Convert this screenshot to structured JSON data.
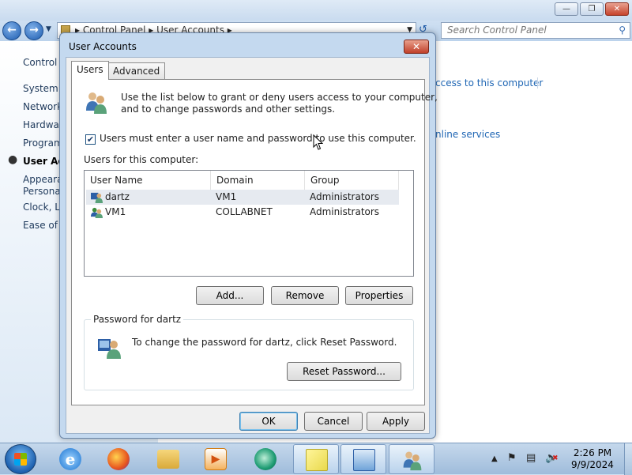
{
  "background_window": {
    "address_crumbs": [
      "Control Panel",
      "User Accounts"
    ],
    "search_placeholder": "Search Control Panel",
    "sidebar": {
      "home": "Control P",
      "items": [
        "System a",
        "Network",
        "Hardwar",
        "Program",
        "User Acc",
        "Appeara",
        "Personal",
        "Clock, La",
        "Ease of A"
      ],
      "current_index": 4
    },
    "links": [
      "ccess to this computer",
      "nline services"
    ]
  },
  "dialog": {
    "title": "User Accounts",
    "tabs": [
      "Users",
      "Advanced"
    ],
    "active_tab": "Users",
    "intro_text_line1": "Use the list below to grant or deny users access to your computer,",
    "intro_text_line2": "and to change passwords and other settings.",
    "checkbox_label": "Users must enter a user name and password to use this computer.",
    "checkbox_checked": true,
    "users_label": "Users for this computer:",
    "columns": [
      "User Name",
      "Domain",
      "Group"
    ],
    "rows": [
      {
        "user": "dartz",
        "domain": "VM1",
        "group": "Administrators",
        "selected": true
      },
      {
        "user": "VM1",
        "domain": "COLLABNET",
        "group": "Administrators",
        "selected": false
      }
    ],
    "buttons": {
      "add": "Add...",
      "remove": "Remove",
      "properties": "Properties"
    },
    "password_group": {
      "legend": "Password for dartz",
      "text": "To change the password for dartz, click Reset Password.",
      "reset_button": "Reset Password..."
    },
    "footer": {
      "ok": "OK",
      "cancel": "Cancel",
      "apply": "Apply"
    }
  },
  "taskbar": {
    "pinned": [
      "internet-explorer-icon",
      "firefox-icon",
      "explorer-folder-icon",
      "media-player-icon",
      "app-icon",
      "sticky-notes-icon",
      "control-panel-icon",
      "user-accounts-icon"
    ],
    "clock_time": "2:26 PM",
    "clock_date": "9/9/2024"
  }
}
